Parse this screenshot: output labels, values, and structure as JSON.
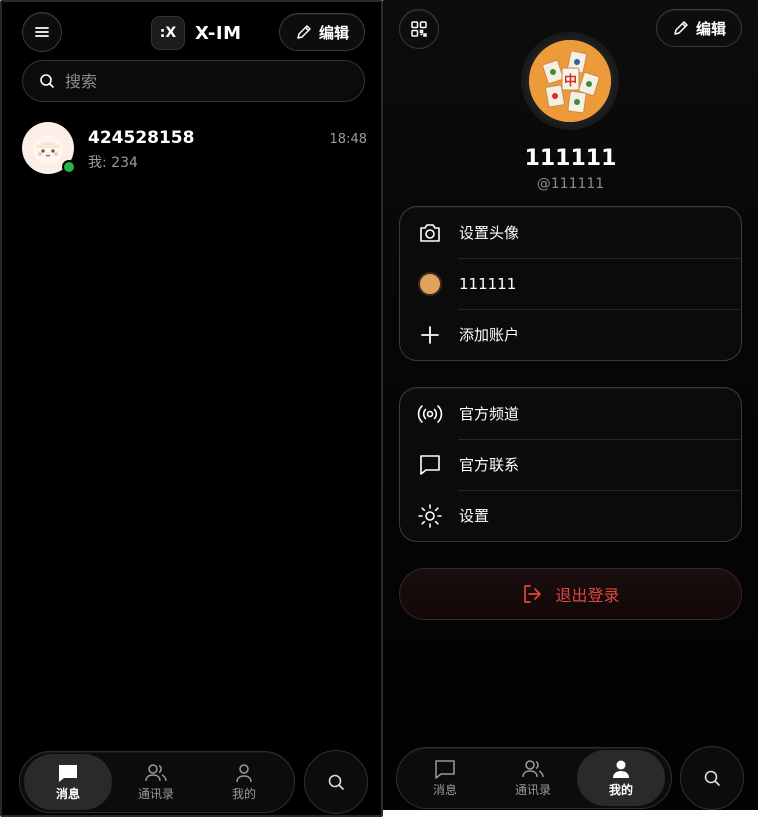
{
  "left": {
    "app_name": "X-IM",
    "logo_glyph": ":X",
    "edit_label": "编辑",
    "search_placeholder": "搜索",
    "chats": [
      {
        "name": "424528158",
        "preview": "我: 234",
        "time": "18:48",
        "online": true
      }
    ],
    "tabs": [
      {
        "label": "消息",
        "icon": "chat-bubble-icon",
        "active": true
      },
      {
        "label": "通讯录",
        "icon": "contacts-icon",
        "active": false
      },
      {
        "label": "我的",
        "icon": "person-icon",
        "active": false
      }
    ]
  },
  "right": {
    "edit_label": "编辑",
    "profile": {
      "name": "111111",
      "handle": "@111111"
    },
    "account_menu": [
      {
        "label": "设置头像",
        "icon": "camera-icon"
      },
      {
        "label": "111111",
        "icon": "account-avatar-icon"
      },
      {
        "label": "添加账户",
        "icon": "plus-icon"
      }
    ],
    "info_menu": [
      {
        "label": "官方频道",
        "icon": "broadcast-icon"
      },
      {
        "label": "官方联系",
        "icon": "message-square-icon"
      },
      {
        "label": "设置",
        "icon": "settings-sun-icon"
      }
    ],
    "logout_label": "退出登录",
    "tabs": [
      {
        "label": "消息",
        "icon": "chat-bubble-icon",
        "active": false
      },
      {
        "label": "通讯录",
        "icon": "contacts-icon",
        "active": false
      },
      {
        "label": "我的",
        "icon": "person-icon",
        "active": true
      }
    ]
  },
  "colors": {
    "online": "#2bb34a",
    "danger": "#e0463f",
    "background": "#000000"
  }
}
